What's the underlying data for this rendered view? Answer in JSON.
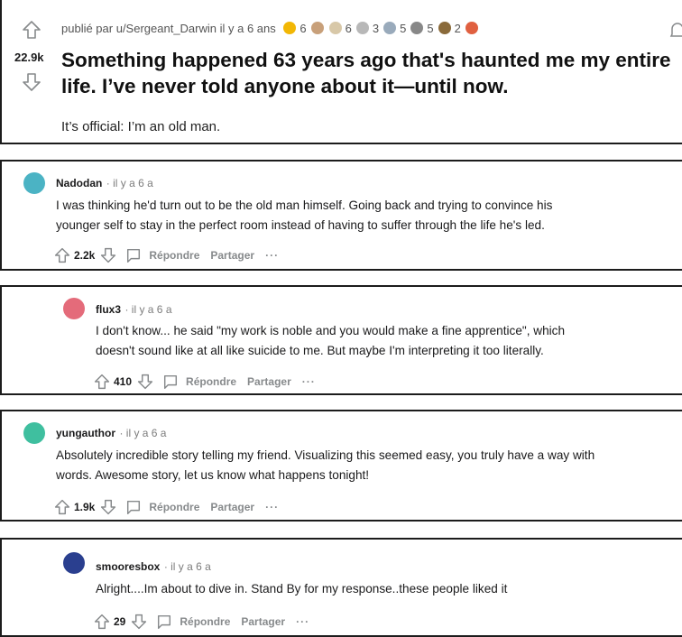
{
  "post": {
    "meta_prefix": "publié par u/Sergeant_Darwin il y a 6 ans",
    "awards": [
      {
        "count": "6",
        "color": "#f2b705"
      },
      {
        "count": "",
        "color": "#c8a07a"
      },
      {
        "count": "6",
        "color": "#d8c8a8"
      },
      {
        "count": "3",
        "color": "#b8b8b8"
      },
      {
        "count": "5",
        "color": "#9ab"
      },
      {
        "count": "5",
        "color": "#888"
      },
      {
        "count": "2",
        "color": "#8a6a3a"
      },
      {
        "count": "",
        "color": "#e06040"
      }
    ],
    "score": "22.9k",
    "title_line1": "Something happened 63 years ago that's haunted me my entire",
    "title_line2": "life. I’ve never told anyone about it—until now.",
    "body": "It’s official: I’m an old man."
  },
  "comments": [
    {
      "username": "Nadodan",
      "time": "· il y a 6 a",
      "body_line1": "I was thinking he'd turn out to be the old man himself. Going back and trying to convince his",
      "body_line2": "younger self to stay in the perfect room instead of having to suffer through the life he's led.",
      "score": "2.2k",
      "reply": "Répondre",
      "share": "Partager",
      "more": "···",
      "avatar_color": "#4bb3c4"
    },
    {
      "username": "flux3",
      "time": "· il y a 6 a",
      "body_line1": "I don't know... he said \"my work is noble and you would make a fine apprentice\", which",
      "body_line2": "doesn't sound like at all like suicide to me. But maybe I'm interpreting it too literally.",
      "score": "410",
      "reply": "Répondre",
      "share": "Partager",
      "more": "···",
      "avatar_color": "#e46b7a"
    },
    {
      "username": "yungauthor",
      "time": "· il y a 6 a",
      "body_line1": "Absolutely incredible story telling my friend. Visualizing this seemed easy, you truly have a way with",
      "body_line2": "words. Awesome story, let us know what happens tonight!",
      "score": "1.9k",
      "reply": "Répondre",
      "share": "Partager",
      "more": "···",
      "avatar_color": "#3fbf9f"
    },
    {
      "username": "smooresbox",
      "time": "· il y a 6 a",
      "body_line1": "Alright....Im about to dive in. Stand By for my response..these people liked it",
      "body_line2": "",
      "score": "29",
      "reply": "Répondre",
      "share": "Partager",
      "more": "···",
      "avatar_color": "#2a3f8f"
    }
  ]
}
